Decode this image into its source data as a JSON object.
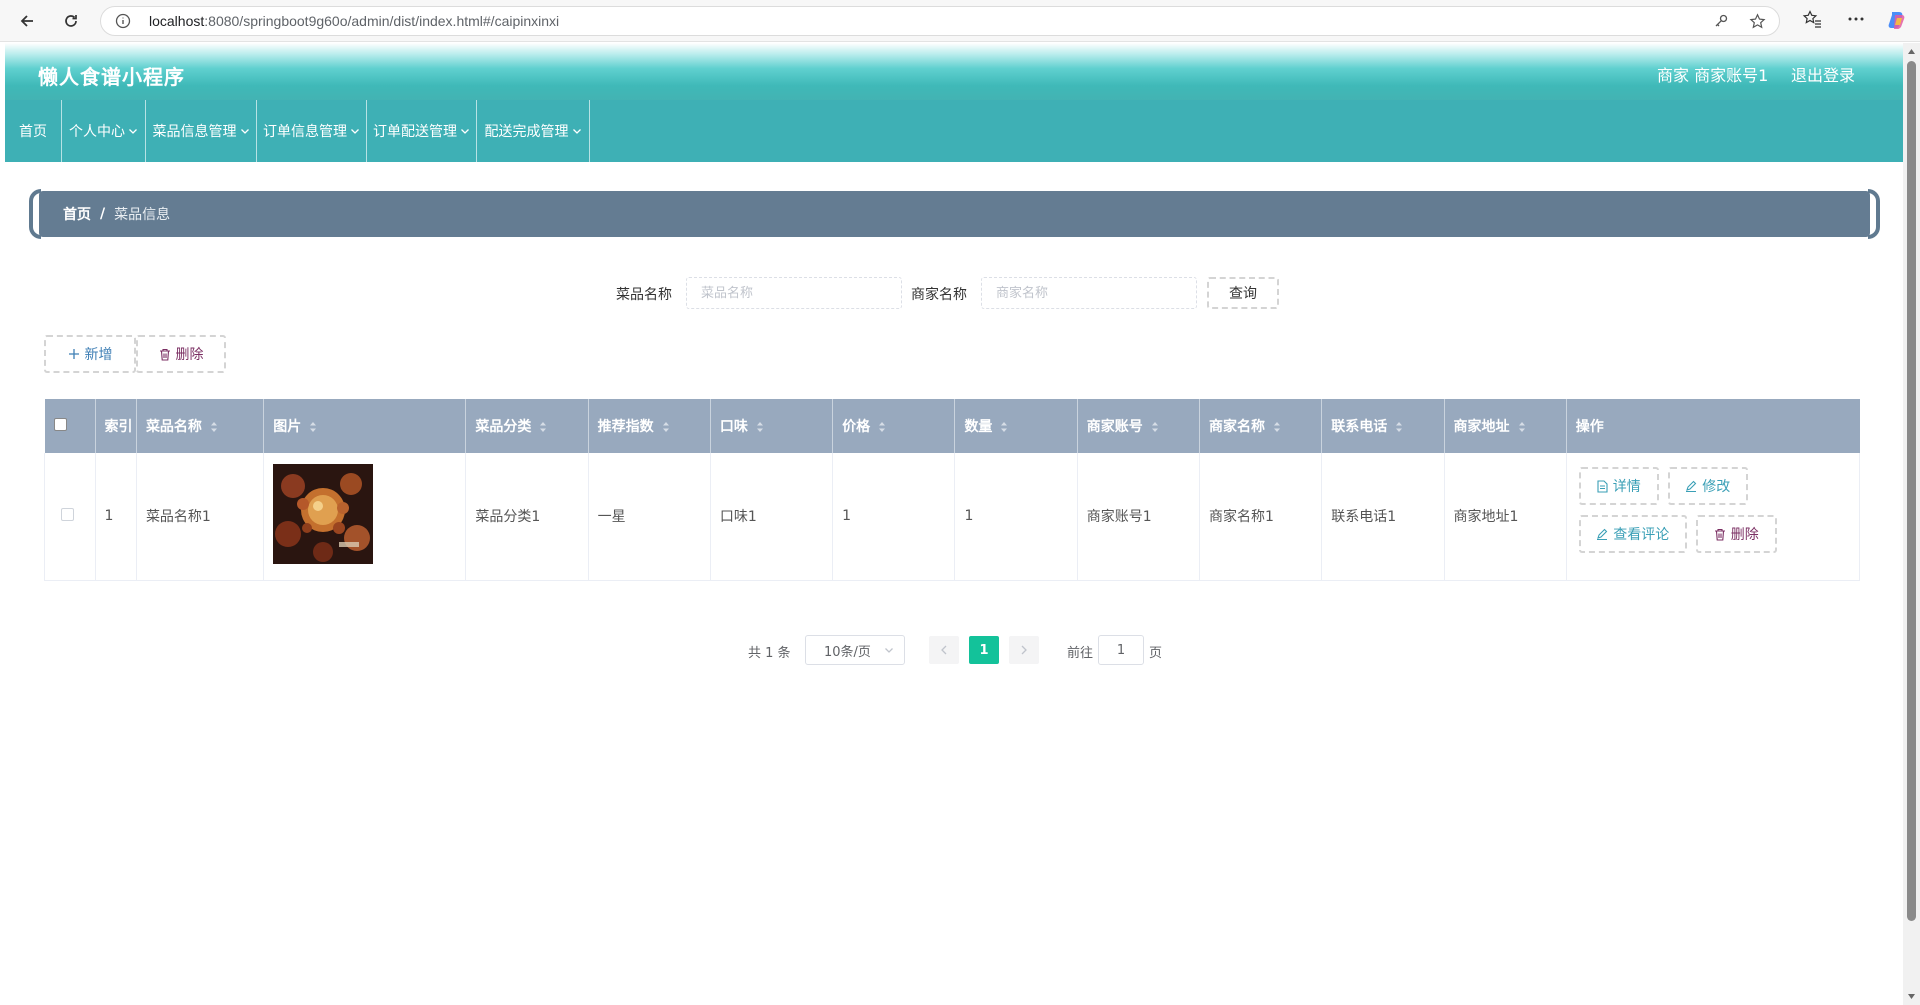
{
  "browser": {
    "url_host": "localhost",
    "url_rest": ":8080/springboot9g60o/admin/dist/index.html#/caipinxinxi"
  },
  "header": {
    "brand": "懒人食谱小程序",
    "user": "商家 商家账号1",
    "logout": "退出登录"
  },
  "nav": {
    "items": [
      {
        "label": "首页",
        "dropdown": false
      },
      {
        "label": "个人中心",
        "dropdown": true
      },
      {
        "label": "菜品信息管理",
        "dropdown": true
      },
      {
        "label": "订单信息管理",
        "dropdown": true
      },
      {
        "label": "订单配送管理",
        "dropdown": true
      },
      {
        "label": "配送完成管理",
        "dropdown": true
      }
    ]
  },
  "breadcrumb": {
    "home": "首页",
    "separator": "/",
    "current": "菜品信息"
  },
  "search": {
    "dish_label": "菜品名称",
    "dish_placeholder": "菜品名称",
    "merchant_label": "商家名称",
    "merchant_placeholder": "商家名称",
    "query_button": "查询"
  },
  "actions": {
    "add": "新增",
    "delete": "删除"
  },
  "table": {
    "headers": [
      "索引",
      "菜品名称",
      "图片",
      "菜品分类",
      "推荐指数",
      "口味",
      "价格",
      "数量",
      "商家账号",
      "商家名称",
      "联系电话",
      "商家地址",
      "操作"
    ],
    "rows": [
      {
        "index": "1",
        "dish_name": "菜品名称1",
        "category": "菜品分类1",
        "recommend": "一星",
        "taste": "口味1",
        "price": "1",
        "quantity": "1",
        "merchant_account": "商家账号1",
        "merchant_name": "商家名称1",
        "phone": "联系电话1",
        "address": "商家地址1"
      }
    ],
    "row_buttons": {
      "detail": "详情",
      "edit": "修改",
      "comments": "查看评论",
      "delete": "删除"
    }
  },
  "pagination": {
    "total": "共 1 条",
    "page_size": "10条/页",
    "current_page": "1",
    "goto_label": "前往",
    "goto_value": "1",
    "page_unit": "页"
  },
  "colors": {
    "header_teal": "#43b3b3",
    "nav_teal": "#3eb0b5",
    "breadcrumb_slate": "#647c92",
    "table_header": "#98a9be",
    "pager_active": "#13c29a"
  }
}
